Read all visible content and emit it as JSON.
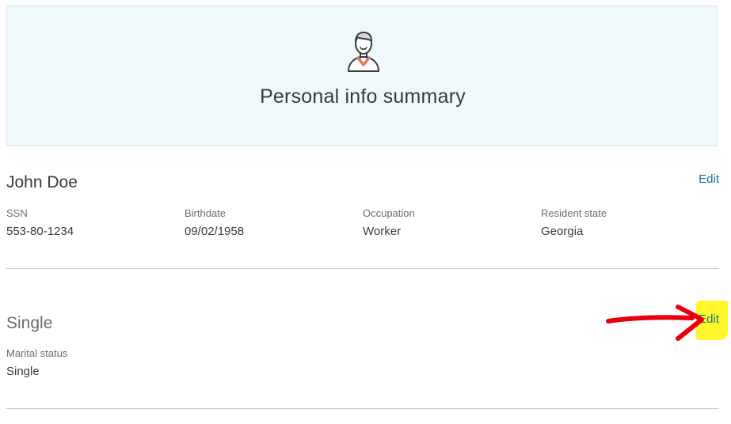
{
  "header": {
    "title": "Personal info summary",
    "icon": "person-avatar-icon"
  },
  "person": {
    "name": "John Doe",
    "edit_label": "Edit",
    "fields": [
      {
        "label": "SSN",
        "value": "553-80-1234"
      },
      {
        "label": "Birthdate",
        "value": "09/02/1958"
      },
      {
        "label": "Occupation",
        "value": "Worker"
      },
      {
        "label": "Resident state",
        "value": "Georgia"
      }
    ]
  },
  "marital": {
    "title": "Single",
    "edit_label": "Edit",
    "fields": [
      {
        "label": "Marital status",
        "value": "Single"
      }
    ]
  },
  "colors": {
    "link": "#0d7588",
    "hero_background": "#eff8fa",
    "annotation_arrow": "#e8000c",
    "annotation_highlight": "#fff62b"
  }
}
